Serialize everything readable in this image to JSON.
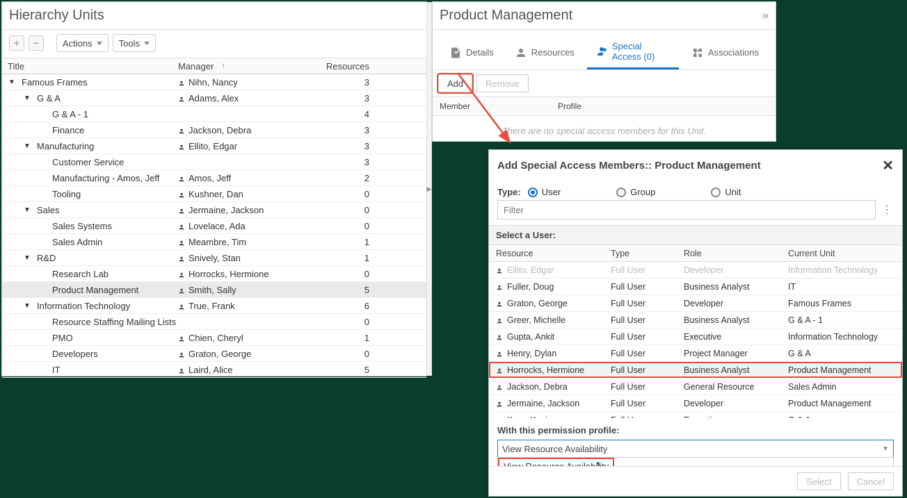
{
  "left": {
    "title": "Hierarchy Units",
    "actions_label": "Actions",
    "tools_label": "Tools",
    "columns": {
      "title": "Title",
      "manager": "Manager",
      "resources": "Resources"
    },
    "rows": [
      {
        "indent": 1,
        "exp": "expanded",
        "title": "Famous Frames",
        "mgr": "Nihn, Nancy",
        "res": "3"
      },
      {
        "indent": 2,
        "exp": "expanded",
        "title": "G & A",
        "mgr": "Adams, Alex",
        "res": "3"
      },
      {
        "indent": 3,
        "exp": "",
        "title": "G & A - 1",
        "mgr": "",
        "res": "4"
      },
      {
        "indent": 3,
        "exp": "",
        "title": "Finance",
        "mgr": "Jackson, Debra",
        "res": "3"
      },
      {
        "indent": 2,
        "exp": "expanded",
        "title": "Manufacturing",
        "mgr": "Ellito, Edgar",
        "res": "3"
      },
      {
        "indent": 3,
        "exp": "",
        "title": "Customer Service",
        "mgr": "",
        "res": "3"
      },
      {
        "indent": 3,
        "exp": "",
        "title": "Manufacturing - Amos, Jeff",
        "mgr": "Amos, Jeff",
        "res": "2"
      },
      {
        "indent": 3,
        "exp": "",
        "title": "Tooling",
        "mgr": "Kushner, Dan",
        "res": "0"
      },
      {
        "indent": 2,
        "exp": "expanded",
        "title": "Sales",
        "mgr": "Jermaine, Jackson",
        "res": "0"
      },
      {
        "indent": 3,
        "exp": "",
        "title": "Sales Systems",
        "mgr": "Lovelace, Ada",
        "res": "0"
      },
      {
        "indent": 3,
        "exp": "",
        "title": "Sales Admin",
        "mgr": "Meambre, Tim",
        "res": "1"
      },
      {
        "indent": 2,
        "exp": "expanded",
        "title": "R&D",
        "mgr": "Snively, Stan",
        "res": "1"
      },
      {
        "indent": 3,
        "exp": "",
        "title": "Research Lab",
        "mgr": "Horrocks, Hermione",
        "res": "0"
      },
      {
        "indent": 3,
        "exp": "",
        "title": "Product Management",
        "mgr": "Smith, Sally",
        "res": "5",
        "selected": true
      },
      {
        "indent": 2,
        "exp": "expanded",
        "title": "Information Technology",
        "mgr": "True, Frank",
        "res": "6"
      },
      {
        "indent": 3,
        "exp": "",
        "title": "Resource Staffing Mailing Lists",
        "mgr": "",
        "res": "0"
      },
      {
        "indent": 3,
        "exp": "",
        "title": "PMO",
        "mgr": "Chien, Cheryl",
        "res": "1"
      },
      {
        "indent": 3,
        "exp": "",
        "title": "Developers",
        "mgr": "Graton, George",
        "res": "0"
      },
      {
        "indent": 3,
        "exp": "",
        "title": "IT",
        "mgr": "Laird, Alice",
        "res": "5"
      }
    ]
  },
  "right": {
    "title": "Product Management",
    "tabs": {
      "details": "Details",
      "resources": "Resources",
      "special": "Special Access (0)",
      "assoc": "Associations"
    },
    "add_label": "Add",
    "remove_label": "Remove",
    "col_member": "Member",
    "col_profile": "Profile",
    "empty": "There are no special access members for this Unit."
  },
  "modal": {
    "title": "Add Special Access Members:: Product Management",
    "type_label": "Type:",
    "opt_user": "User",
    "opt_group": "Group",
    "opt_unit": "Unit",
    "filter_placeholder": "Filter",
    "select_label": "Select a User:",
    "cols": {
      "res": "Resource",
      "typ": "Type",
      "rol": "Role",
      "cur": "Current Unit"
    },
    "rows": [
      {
        "res": "Ellito, Edgar",
        "typ": "Full User",
        "rol": "Developer",
        "cur": "Information Technology",
        "cut": true
      },
      {
        "res": "Fuller, Doug",
        "typ": "Full User",
        "rol": "Business Analyst",
        "cur": "IT"
      },
      {
        "res": "Graton, George",
        "typ": "Full User",
        "rol": "Developer",
        "cur": "Famous Frames"
      },
      {
        "res": "Greer, Michelle",
        "typ": "Full User",
        "rol": "Business Analyst",
        "cur": "G & A - 1"
      },
      {
        "res": "Gupta, Ankit",
        "typ": "Full User",
        "rol": "Executive",
        "cur": "Information Technology"
      },
      {
        "res": "Henry, Dylan",
        "typ": "Full User",
        "rol": "Project Manager",
        "cur": "G & A"
      },
      {
        "res": "Horrocks, Hermione",
        "typ": "Full User",
        "rol": "Business Analyst",
        "cur": "Product Management",
        "highlight": true
      },
      {
        "res": "Jackson, Debra",
        "typ": "Full User",
        "rol": "General Resource",
        "cur": "Sales Admin"
      },
      {
        "res": "Jermaine, Jackson",
        "typ": "Full User",
        "rol": "Developer",
        "cur": "Product Management"
      },
      {
        "res": "Kern, Kevin",
        "typ": "Full User",
        "rol": "Executive",
        "cur": "G & A"
      }
    ],
    "perm_label": "With this permission profile:",
    "perm_value": "View Resource Availability",
    "perm_option": "View Resource Availability",
    "select_btn": "Select",
    "cancel_btn": "Cancel"
  }
}
